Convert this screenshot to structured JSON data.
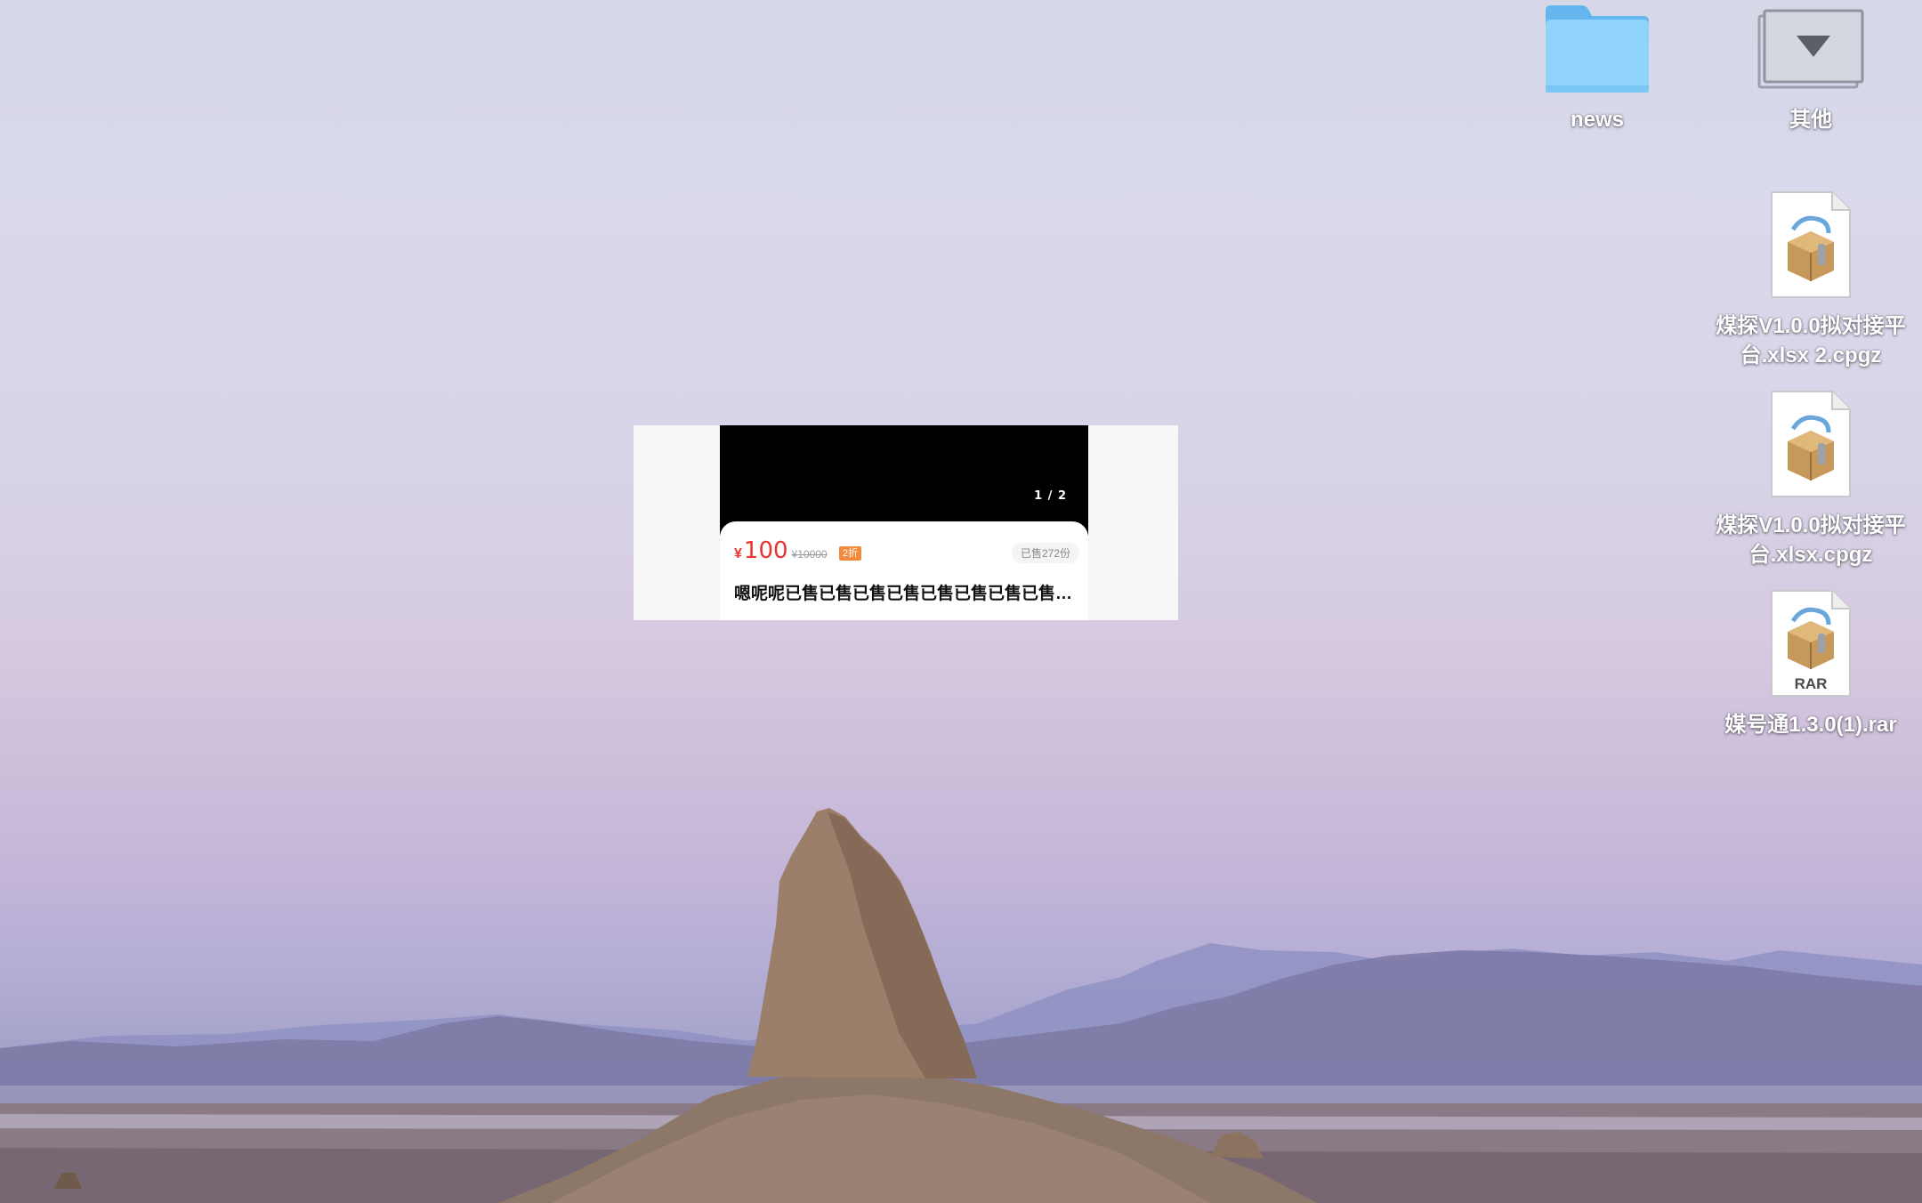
{
  "desktop": {
    "icons": [
      {
        "id": "news",
        "label": "news",
        "kind": "folder",
        "icon": "folder-icon"
      },
      {
        "id": "other",
        "label": "其他",
        "kind": "download-stack",
        "icon": "download-folder-icon"
      },
      {
        "id": "file1",
        "label": "煤探V1.0.0拟对接平台.xlsx 2.cpgz",
        "kind": "archive",
        "icon": "archive-icon"
      },
      {
        "id": "file2",
        "label": "煤探V1.0.0拟对接平台.xlsx.cpgz",
        "kind": "archive",
        "icon": "archive-icon"
      },
      {
        "id": "rar",
        "label": "媒号通1.3.0(1).rar",
        "kind": "archive",
        "icon": "rar-archive-icon",
        "badge": "RAR"
      }
    ]
  },
  "preview": {
    "counter": "1 / 2",
    "price_symbol": "¥",
    "price": "100",
    "original_price": "¥10000",
    "discount": "2折",
    "sold": "已售272份",
    "title": "嗯呢呢已售已售已售已售已售已售已售已售已售已售"
  },
  "colors": {
    "price": "#e8352f",
    "discount_badge": "#f38a3c",
    "folder": "#7cc8f4"
  }
}
